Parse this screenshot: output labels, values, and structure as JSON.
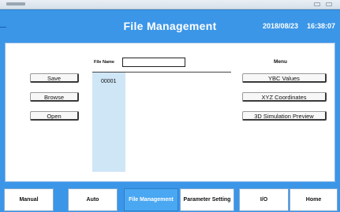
{
  "app": {
    "title": "File Management",
    "date": "2018/08/23",
    "time": "16:38:07"
  },
  "left_buttons": [
    {
      "label": "Save"
    },
    {
      "label": "Browse"
    },
    {
      "label": "Open"
    }
  ],
  "file_name": {
    "label": "File Name",
    "value": ""
  },
  "file_list": [
    "00001"
  ],
  "menu": {
    "title": "Menu",
    "items": [
      {
        "label": "YBC Values"
      },
      {
        "label": "XYZ Coordinates"
      },
      {
        "label": "3D Simulation Preview"
      }
    ]
  },
  "nav": {
    "active_index": 2,
    "items": [
      {
        "label": "Manual"
      },
      {
        "label": "Auto"
      },
      {
        "label": "File Management"
      },
      {
        "label": "Parameter Setting"
      },
      {
        "label": "I/O"
      },
      {
        "label": "Home"
      }
    ]
  },
  "colors": {
    "frame_blue": "#3b96e8",
    "active_tab": "#4aa7f2",
    "list_bg": "#cfe6f7"
  }
}
